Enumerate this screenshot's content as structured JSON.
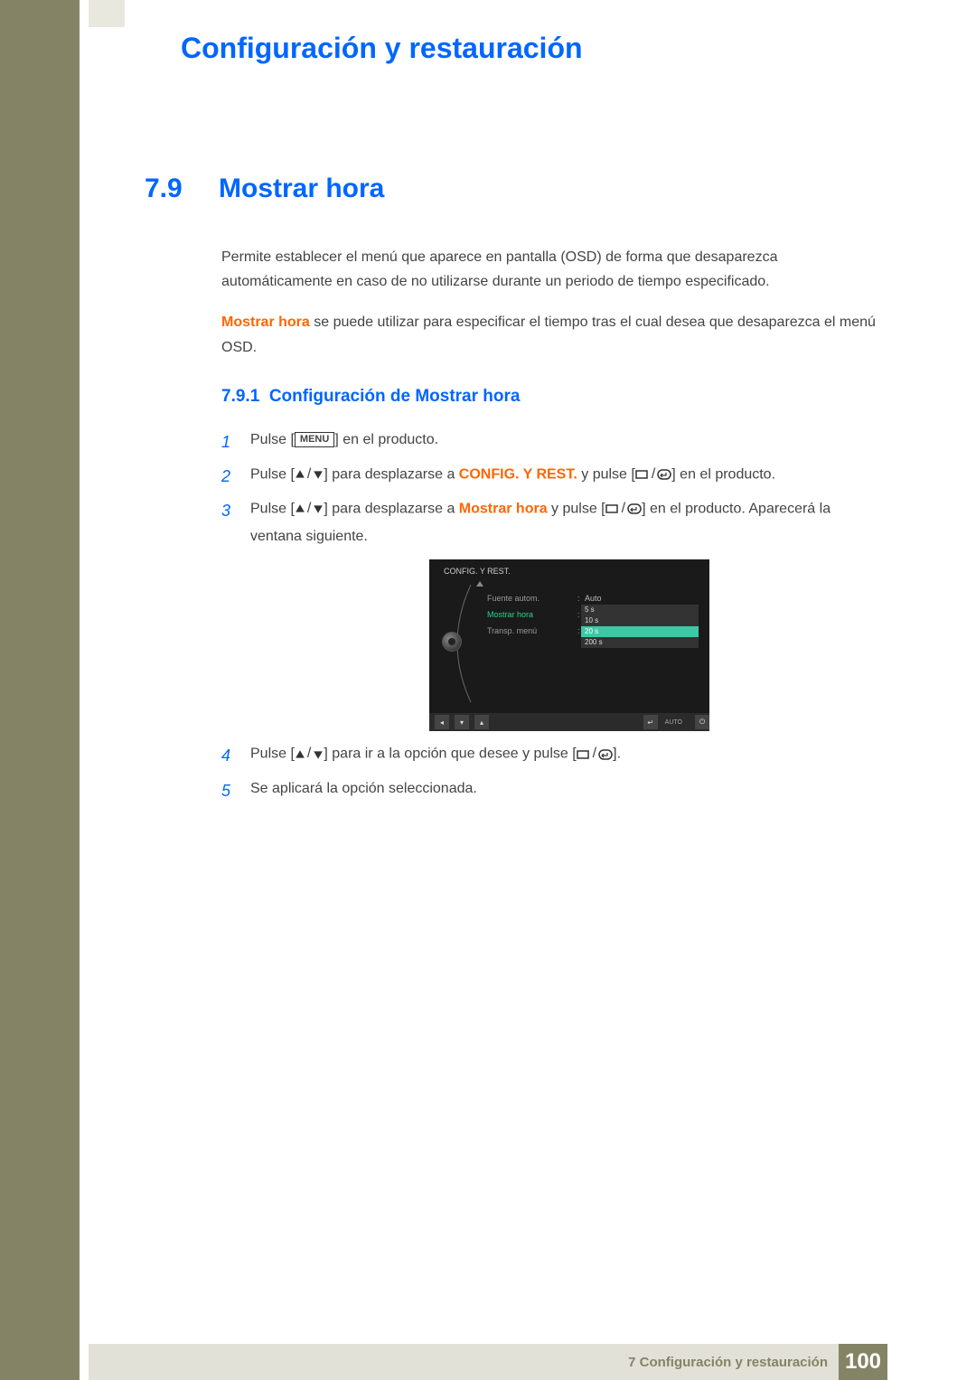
{
  "header": {
    "chapter_title": "Configuración y restauración"
  },
  "section": {
    "number": "7.9",
    "title": "Mostrar hora"
  },
  "intro": {
    "p1": "Permite establecer el menú que aparece en pantalla (OSD) de forma que desaparezca automáticamente en caso de no utilizarse durante un periodo de tiempo especificado.",
    "p2_bold": "Mostrar hora",
    "p2_rest": " se puede utilizar para especificar el tiempo tras el cual desea que desaparezca el menú OSD."
  },
  "subsection": {
    "number": "7.9.1",
    "title": "Configuración de Mostrar hora"
  },
  "steps": {
    "s1": {
      "num": "1",
      "pre": "Pulse [",
      "menu": "MENU",
      "post": "] en el producto."
    },
    "s2": {
      "num": "2",
      "pre": "Pulse [",
      "mid": "] para desplazarse a ",
      "bold": "CONFIG. Y REST.",
      "mid2": " y pulse [",
      "post": "] en el producto."
    },
    "s3": {
      "num": "3",
      "pre": "Pulse [",
      "mid": "] para desplazarse a ",
      "bold": "Mostrar hora",
      "mid2": " y pulse [",
      "post": "] en el producto. Aparecerá la ventana siguiente."
    },
    "s4": {
      "num": "4",
      "pre": "Pulse [",
      "mid": "] para ir a la opción que desee y pulse [",
      "post": "]."
    },
    "s5": {
      "num": "5",
      "text": "Se aplicará la opción seleccionada."
    }
  },
  "osd": {
    "title": "CONFIG. Y REST.",
    "rows": [
      {
        "label": "Fuente autom.",
        "value": "Auto"
      },
      {
        "label": "Mostrar hora",
        "value": ""
      },
      {
        "label": "Transp. menú",
        "value": ""
      }
    ],
    "options": [
      "5 s",
      "10 s",
      "20 s",
      "200 s"
    ],
    "selected_index": 2,
    "auto_label": "AUTO"
  },
  "footer": {
    "chapter_ref": "7 Configuración y restauración",
    "page": "100"
  }
}
